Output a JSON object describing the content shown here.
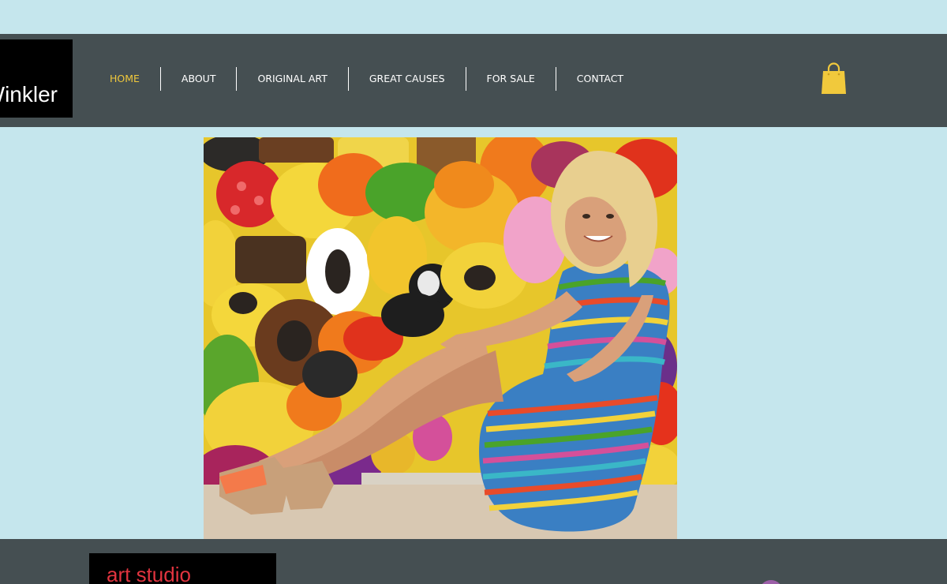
{
  "brand": {
    "logo_text": "Winkler"
  },
  "nav": {
    "items": [
      {
        "label": "HOME",
        "active": true
      },
      {
        "label": "ABOUT",
        "active": false
      },
      {
        "label": "ORIGINAL ART",
        "active": false
      },
      {
        "label": "GREAT CAUSES",
        "active": false
      },
      {
        "label": "FOR SALE",
        "active": false
      },
      {
        "label": "CONTACT",
        "active": false
      }
    ]
  },
  "cart": {
    "icon": "shopping-bag-icon",
    "color": "#f1c93c"
  },
  "hero": {
    "image": "artist-seated-before-candy-painting"
  },
  "footer": {
    "studio_label": "art studio"
  },
  "colors": {
    "background": "#c5e6ed",
    "header": "#454f52",
    "accent": "#f1c93c",
    "studio_text": "#e1343f"
  }
}
